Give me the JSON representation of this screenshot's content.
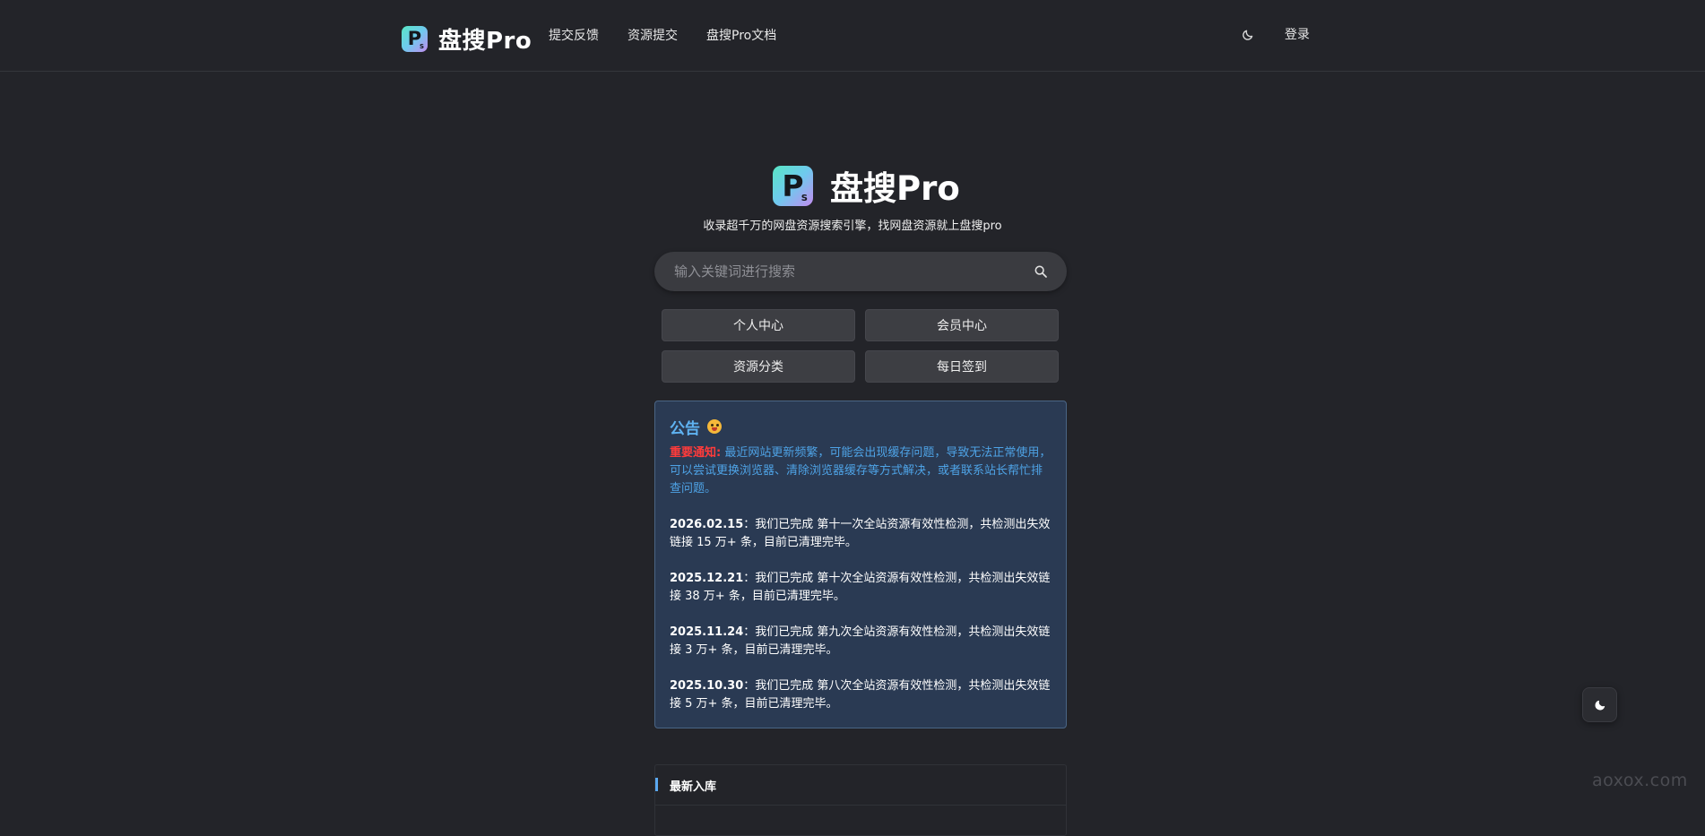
{
  "header": {
    "brand_name": "盘搜Pro",
    "nav": [
      {
        "label": "提交反馈"
      },
      {
        "label": "资源提交"
      },
      {
        "label": "盘搜Pro文档"
      }
    ],
    "theme_icon": "moon-icon",
    "login_label": "登录"
  },
  "hero": {
    "logo_letter": "P",
    "logo_sub": "S",
    "name": "盘搜Pro",
    "tagline": "收录超千万的网盘资源搜索引擎，找网盘资源就上盘搜pro"
  },
  "search": {
    "placeholder": "输入关键词进行搜索",
    "value": "",
    "icon": "search-icon"
  },
  "quick_links": [
    {
      "label": "个人中心"
    },
    {
      "label": "会员中心"
    },
    {
      "label": "资源分类"
    },
    {
      "label": "每日签到"
    }
  ],
  "notice": {
    "title": "公告",
    "emoji_icon": "kiss-emoji-icon",
    "warning_label": "重要通知:",
    "warning_text": " 最近网站更新频繁，可能会出现缓存问题，导致无法正常使用，可以尝试更换浏览器、清除浏览器缓存等方式解决，或者联系站长帮忙排查问题。",
    "items": [
      {
        "date": "2026.02.15",
        "text": "：我们已完成 第十一次全站资源有效性检测，共检测出失效链接 15 万+ 条，目前已清理完毕。"
      },
      {
        "date": "2025.12.21",
        "text": "：我们已完成 第十次全站资源有效性检测，共检测出失效链接 38 万+ 条，目前已清理完毕。"
      },
      {
        "date": "2025.11.24",
        "text": "：我们已完成 第九次全站资源有效性检测，共检测出失效链接 3 万+ 条，目前已清理完毕。"
      },
      {
        "date": "2025.10.30",
        "text": "：我们已完成 第八次全站资源有效性检测，共检测出失效链接 5 万+ 条，目前已清理完毕。"
      }
    ]
  },
  "latest": {
    "title": "最新入库"
  },
  "floating": {
    "theme_icon": "moon-icon"
  },
  "watermark": "aoxox.com",
  "colors": {
    "background": "#232429",
    "notice_bg": "#2a3a53",
    "notice_title": "#5fb3f2",
    "warning_label": "#ff3b3b",
    "accent_bar": "#5aa8f0"
  }
}
